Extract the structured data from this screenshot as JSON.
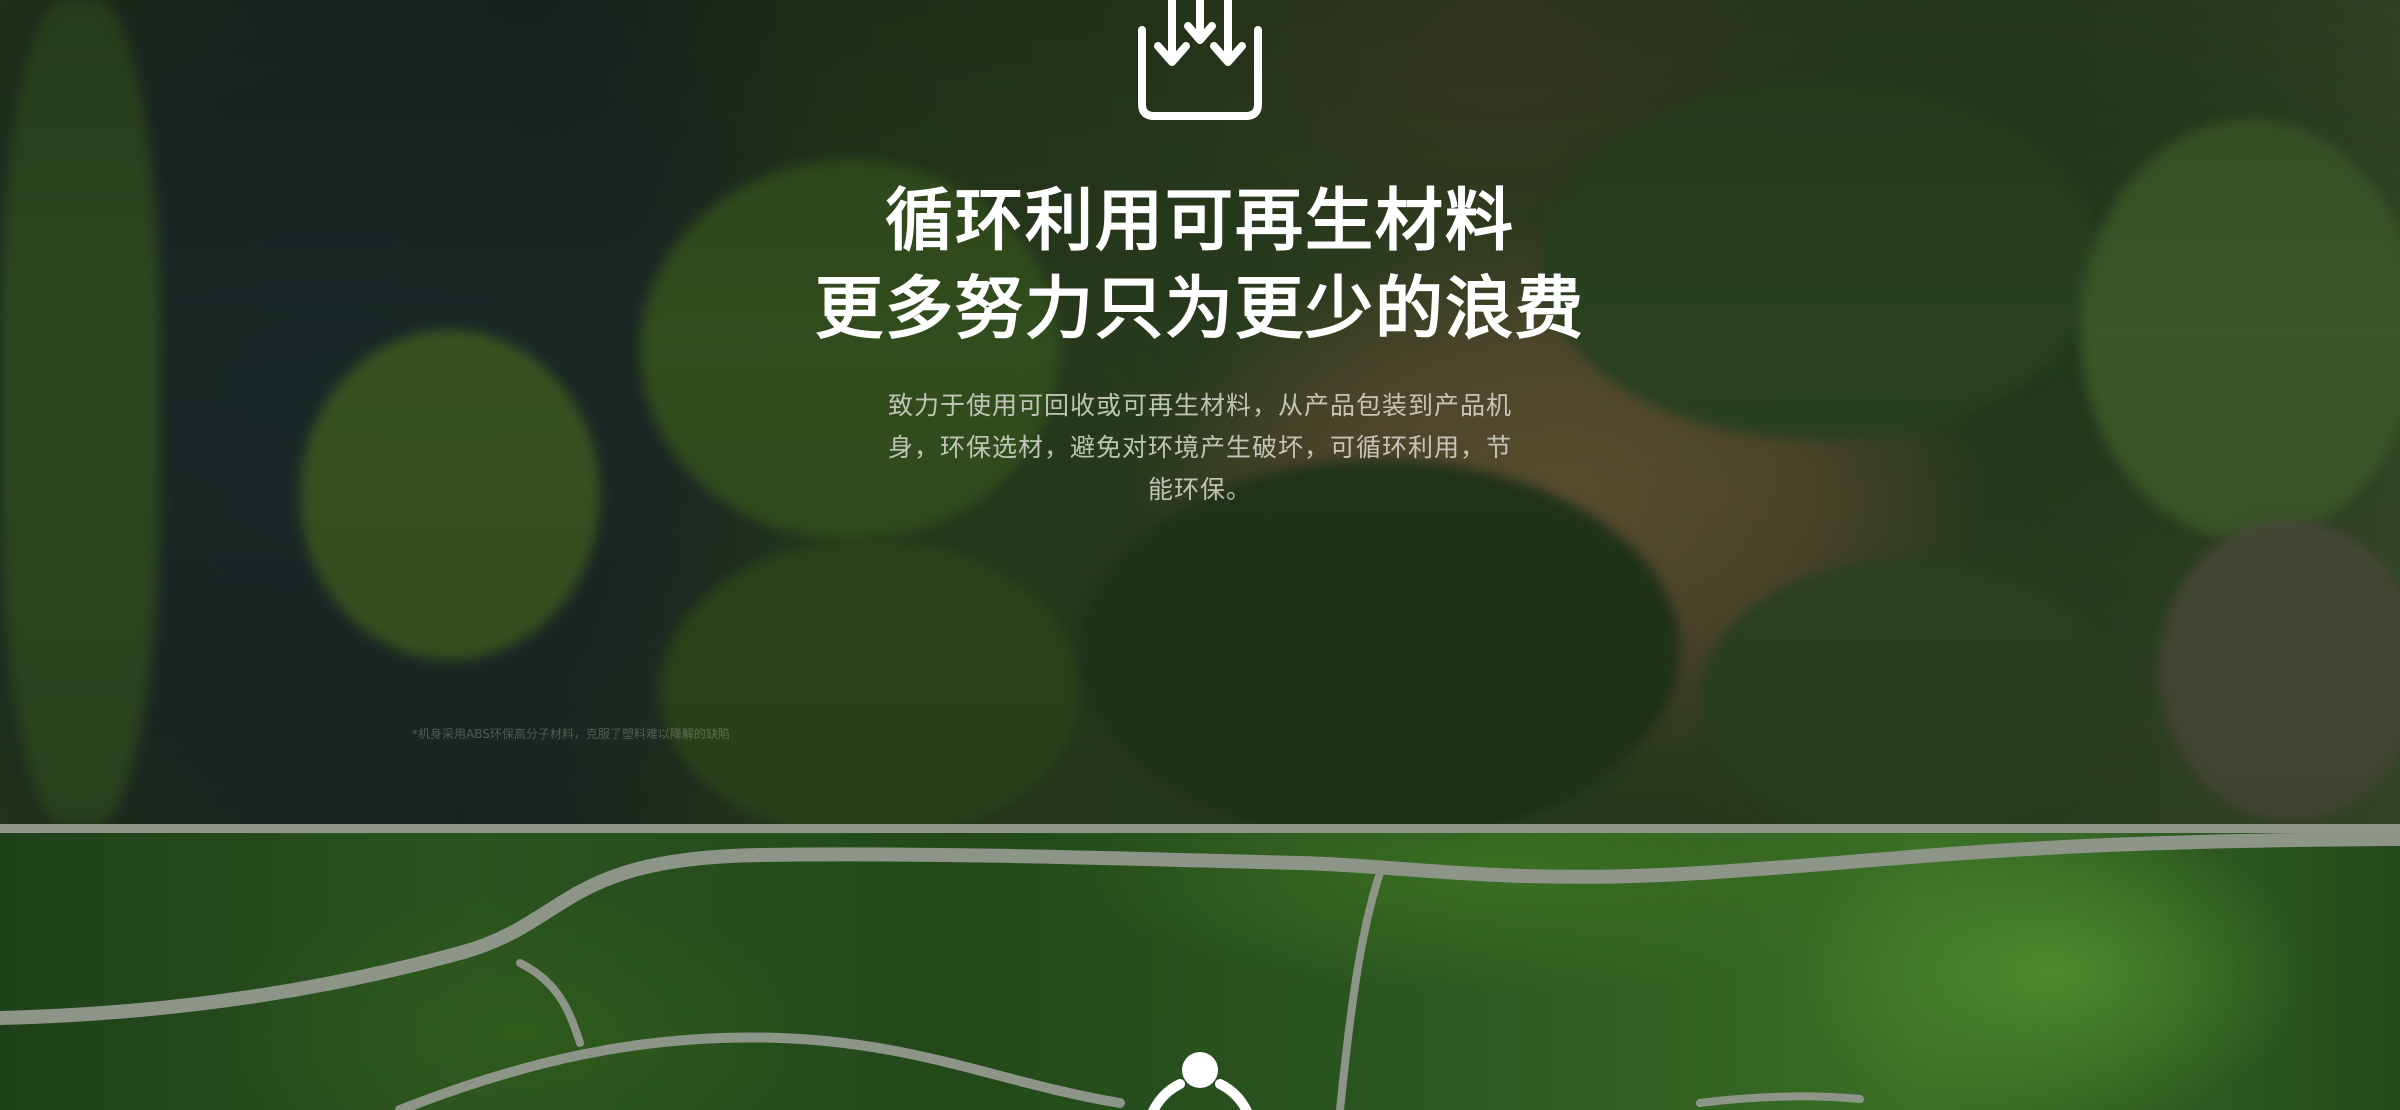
{
  "section_recycle": {
    "icon": "download-tray-icon",
    "headline_line1": "循环利用可再生材料",
    "headline_line2": "更多努力只为更少的浪费",
    "description": "致力于使用可回收或可再生材料，从产品包装到产品机身，环保选材，避免对环境产生破坏，可循环利用，节能环保。",
    "footnote": "*机身采用ABS环保高分子材料，克服了塑料难以降解的缺陷"
  },
  "section_next": {
    "icon": "person-circle-icon"
  },
  "colors": {
    "headline": "#ffffff",
    "description": "#e1e1d7",
    "divider": "#8f978c"
  }
}
